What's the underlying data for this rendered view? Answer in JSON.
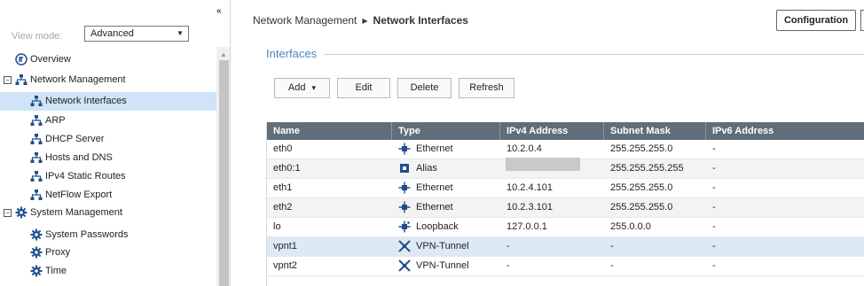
{
  "sidebar": {
    "collapse_glyph": "«",
    "view_mode_label": "View mode:",
    "view_mode_value": "Advanced",
    "tree": [
      {
        "label": "Overview",
        "icon": "overview-icon"
      },
      {
        "label": "Network Management",
        "icon": "network-icon",
        "expander": "−"
      },
      {
        "label": "Network Interfaces",
        "icon": "network-icon",
        "selected": true
      },
      {
        "label": "ARP",
        "icon": "network-icon"
      },
      {
        "label": "DHCP Server",
        "icon": "network-icon"
      },
      {
        "label": "Hosts and DNS",
        "icon": "network-icon"
      },
      {
        "label": "IPv4 Static Routes",
        "icon": "network-icon"
      },
      {
        "label": "NetFlow Export",
        "icon": "network-icon"
      },
      {
        "label": "System Management",
        "icon": "gear-icon",
        "expander": "−"
      },
      {
        "label": "System Passwords",
        "icon": "gear-icon"
      },
      {
        "label": "Proxy",
        "icon": "gear-icon"
      },
      {
        "label": "Time",
        "icon": "gear-icon"
      }
    ]
  },
  "header": {
    "breadcrumb_parent": "Network Management",
    "breadcrumb_sep": "▶",
    "breadcrumb_current": "Network Interfaces",
    "config_button": "Configuration"
  },
  "section": {
    "title": "Interfaces"
  },
  "toolbar": {
    "add": "Add",
    "add_caret": "▾",
    "edit": "Edit",
    "delete": "Delete",
    "refresh": "Refresh"
  },
  "table": {
    "columns": [
      "Name",
      "Type",
      "IPv4 Address",
      "Subnet Mask",
      "IPv6 Address"
    ],
    "rows": [
      {
        "name": "eth0",
        "type": "Ethernet",
        "icon": "ethernet-icon",
        "ipv4": "10.2.0.4",
        "mask": "255.255.255.0",
        "ipv6": "-"
      },
      {
        "name": "eth0:1",
        "type": "Alias",
        "icon": "alias-icon",
        "ipv4": "",
        "mask": "255.255.255.255",
        "ipv6": "-"
      },
      {
        "name": "eth1",
        "type": "Ethernet",
        "icon": "ethernet-icon",
        "ipv4": "10.2.4.101",
        "mask": "255.255.255.0",
        "ipv6": "-"
      },
      {
        "name": "eth2",
        "type": "Ethernet",
        "icon": "ethernet-icon",
        "ipv4": "10.2.3.101",
        "mask": "255.255.255.0",
        "ipv6": "-"
      },
      {
        "name": "lo",
        "type": "Loopback",
        "icon": "loopback-icon",
        "ipv4": "127.0.0.1",
        "mask": "255.0.0.0",
        "ipv6": "-"
      },
      {
        "name": "vpnt1",
        "type": "VPN-Tunnel",
        "icon": "vpn-tunnel-icon",
        "ipv4": "-",
        "mask": "-",
        "ipv6": "-"
      },
      {
        "name": "vpnt2",
        "type": "VPN-Tunnel",
        "icon": "vpn-tunnel-icon",
        "ipv4": "-",
        "mask": "-",
        "ipv6": "-"
      }
    ]
  },
  "colors": {
    "accent": "#4d86c1",
    "header_bg": "#5f6e7a",
    "selected": "#cfe4f7",
    "icon": "#1f4e8c"
  }
}
